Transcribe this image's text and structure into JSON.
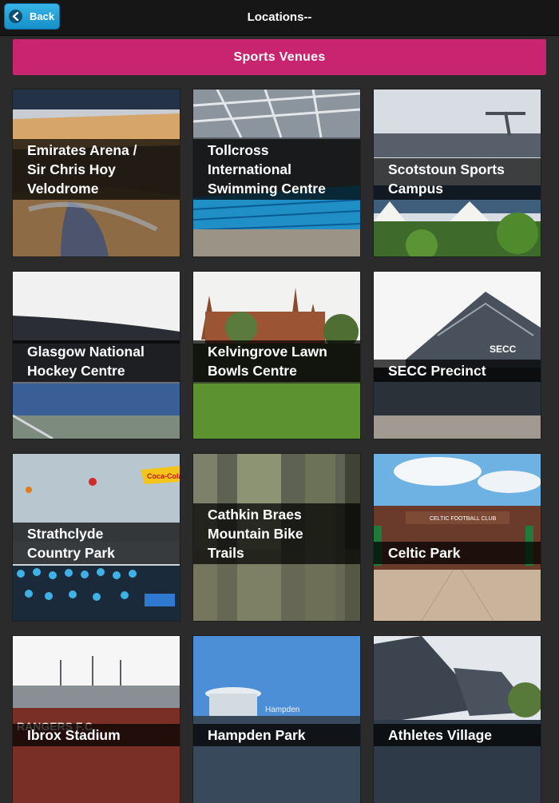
{
  "nav": {
    "back_label": "Back",
    "title": "Locations--"
  },
  "header": {
    "title": "Sports Venues"
  },
  "venues": [
    {
      "lines": [
        "Emirates Arena /",
        "Sir Chris Hoy",
        "Velodrome"
      ]
    },
    {
      "lines": [
        "Tollcross",
        "International",
        "Swimming Centre"
      ]
    },
    {
      "lines": [
        "Scotstoun Sports",
        "Campus"
      ]
    },
    {
      "lines": [
        "Glasgow National",
        "Hockey Centre"
      ]
    },
    {
      "lines": [
        "Kelvingrove Lawn",
        "Bowls Centre"
      ]
    },
    {
      "lines": [
        "SECC Precinct"
      ]
    },
    {
      "lines": [
        "Strathclyde",
        "Country Park"
      ]
    },
    {
      "lines": [
        "Cathkin Braes",
        "Mountain Bike",
        "Trails"
      ]
    },
    {
      "lines": [
        "Celtic Park"
      ]
    },
    {
      "lines": [
        "Ibrox Stadium"
      ]
    },
    {
      "lines": [
        "Hampden Park"
      ]
    },
    {
      "lines": [
        "Athletes Village"
      ]
    }
  ],
  "image_text": {
    "secc_sign": "SECC",
    "celtic_sign": "CELTIC FOOTBALL CLUB",
    "rangers_sign": "RANGERS F.C.",
    "hampden_sign": "Hampden",
    "buoy_sign": "Coca-Cola"
  }
}
